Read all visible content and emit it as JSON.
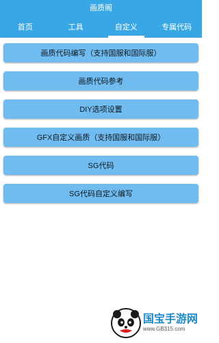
{
  "app": {
    "title": "画质阁"
  },
  "tabs": [
    {
      "label": "首页"
    },
    {
      "label": "工具"
    },
    {
      "label": "自定义"
    },
    {
      "label": "专属代码"
    }
  ],
  "active_tab_index": 2,
  "buttons": [
    {
      "label": "画质代码编写（支持国服和国际服）"
    },
    {
      "label": "画质代码参考"
    },
    {
      "label": "DIY选项设置"
    },
    {
      "label": "GFX自定义画质（支持国服和国际服）"
    },
    {
      "label": "SG代码"
    },
    {
      "label": "SG代码自定义编写"
    }
  ],
  "watermark": {
    "brand": "国宝手游网",
    "url": "www.GB315.com",
    "icon": "panda-logo-icon"
  },
  "colors": {
    "appbar": "#39a7e6",
    "button": "#70bcf0"
  }
}
